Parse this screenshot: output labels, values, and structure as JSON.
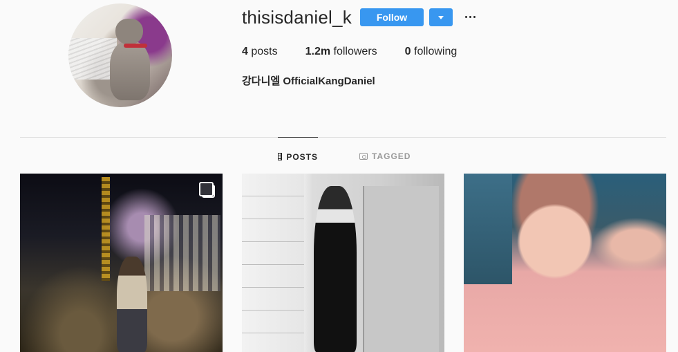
{
  "profile": {
    "username": "thisisdaniel_k",
    "full_name": "강다니엘 OfficialKangDaniel",
    "follow_label": "Follow",
    "avatar_alt": "Profile photo"
  },
  "stats": {
    "posts_count": "4",
    "posts_label": " posts",
    "followers_count": "1.2m",
    "followers_label": " followers",
    "following_count": "0",
    "following_label": " following"
  },
  "tabs": [
    {
      "label": "POSTS",
      "icon": "grid-icon",
      "active": true
    },
    {
      "label": "TAGGED",
      "icon": "tag-icon",
      "active": false
    }
  ],
  "posts": [
    {
      "kind": "carousel",
      "icon": "multi-photo-icon"
    },
    {
      "kind": "photo"
    },
    {
      "kind": "photo"
    }
  ],
  "colors": {
    "accent": "#3897f0",
    "background": "#fafafa",
    "text": "#262626",
    "muted": "#999999",
    "divider": "#dbdbdb"
  }
}
